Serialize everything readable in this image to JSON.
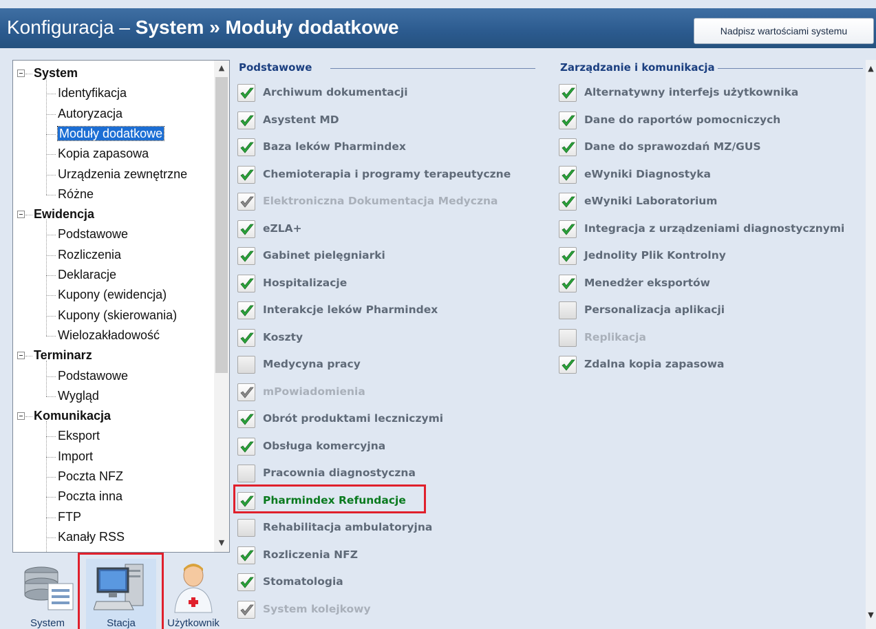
{
  "header": {
    "title_prefix": "Konfiguracja – ",
    "title_bold": "System » Moduły dodatkowe",
    "override_button": "Nadpisz wartościami systemu"
  },
  "tree": [
    {
      "label": "System",
      "group": true
    },
    {
      "label": "Identyfikacja"
    },
    {
      "label": "Autoryzacja"
    },
    {
      "label": "Moduły dodatkowe",
      "selected": true
    },
    {
      "label": "Kopia zapasowa"
    },
    {
      "label": "Urządzenia zewnętrzne"
    },
    {
      "label": "Różne"
    },
    {
      "label": "Ewidencja",
      "group": true
    },
    {
      "label": "Podstawowe"
    },
    {
      "label": "Rozliczenia"
    },
    {
      "label": "Deklaracje"
    },
    {
      "label": "Kupony (ewidencja)"
    },
    {
      "label": "Kupony (skierowania)"
    },
    {
      "label": "Wielozakładowość"
    },
    {
      "label": "Terminarz",
      "group": true
    },
    {
      "label": "Podstawowe"
    },
    {
      "label": "Wygląd"
    },
    {
      "label": "Komunikacja",
      "group": true
    },
    {
      "label": "Eksport"
    },
    {
      "label": "Import"
    },
    {
      "label": "Poczta NFZ"
    },
    {
      "label": "Poczta inna"
    },
    {
      "label": "FTP"
    },
    {
      "label": "Kanały RSS"
    }
  ],
  "tiles": [
    {
      "label": "System",
      "icon": "database-icon"
    },
    {
      "label": "Stacja",
      "icon": "workstation-icon",
      "active": true
    },
    {
      "label": "Użytkownik",
      "icon": "doctor-user-icon"
    }
  ],
  "sections": {
    "basic": {
      "title": "Podstawowe",
      "items": [
        {
          "label": "Archiwum dokumentacji",
          "state": "checked"
        },
        {
          "label": "Asystent MD",
          "state": "checked"
        },
        {
          "label": "Baza leków Pharmindex",
          "state": "checked"
        },
        {
          "label": "Chemioterapia i programy terapeutyczne",
          "state": "checked"
        },
        {
          "label": "Elektroniczna Dokumentacja Medyczna",
          "state": "checked-disabled"
        },
        {
          "label": "eZLA+",
          "state": "checked"
        },
        {
          "label": "Gabinet pielęgniarki",
          "state": "checked"
        },
        {
          "label": "Hospitalizacje",
          "state": "checked"
        },
        {
          "label": "Interakcje leków Pharmindex",
          "state": "checked"
        },
        {
          "label": "Koszty",
          "state": "checked"
        },
        {
          "label": "Medycyna pracy",
          "state": "unchecked"
        },
        {
          "label": "mPowiadomienia",
          "state": "checked-disabled"
        },
        {
          "label": "Obrót produktami leczniczymi",
          "state": "checked"
        },
        {
          "label": "Obsługa komercyjna",
          "state": "checked"
        },
        {
          "label": "Pracownia diagnostyczna",
          "state": "unchecked"
        },
        {
          "label": "Pharmindex Refundacje",
          "state": "checked",
          "highlight": true
        },
        {
          "label": "Rehabilitacja ambulatoryjna",
          "state": "unchecked"
        },
        {
          "label": "Rozliczenia NFZ",
          "state": "checked"
        },
        {
          "label": "Stomatologia",
          "state": "checked"
        },
        {
          "label": "System kolejkowy",
          "state": "checked-disabled"
        }
      ]
    },
    "management": {
      "title": "Zarządzanie i komunikacja",
      "items": [
        {
          "label": "Alternatywny interfejs użytkownika",
          "state": "checked"
        },
        {
          "label": "Dane do raportów pomocniczych",
          "state": "checked"
        },
        {
          "label": "Dane do sprawozdań MZ/GUS",
          "state": "checked"
        },
        {
          "label": "eWyniki Diagnostyka",
          "state": "checked"
        },
        {
          "label": "eWyniki Laboratorium",
          "state": "checked"
        },
        {
          "label": "Integracja z urządzeniami diagnostycznymi",
          "state": "checked"
        },
        {
          "label": "Jednolity Plik Kontrolny",
          "state": "checked"
        },
        {
          "label": "Menedżer eksportów",
          "state": "checked"
        },
        {
          "label": "Personalizacja aplikacji",
          "state": "unchecked"
        },
        {
          "label": "Replikacja",
          "state": "unchecked-disabled"
        },
        {
          "label": "Zdalna kopia zapasowa",
          "state": "checked"
        }
      ]
    }
  },
  "colors": {
    "header": "#2b5a8e",
    "check_green": "#2aa33a",
    "check_gray": "#8a8a8a",
    "highlight_border": "#e0202c",
    "highlight_text": "#0a7a1f"
  }
}
